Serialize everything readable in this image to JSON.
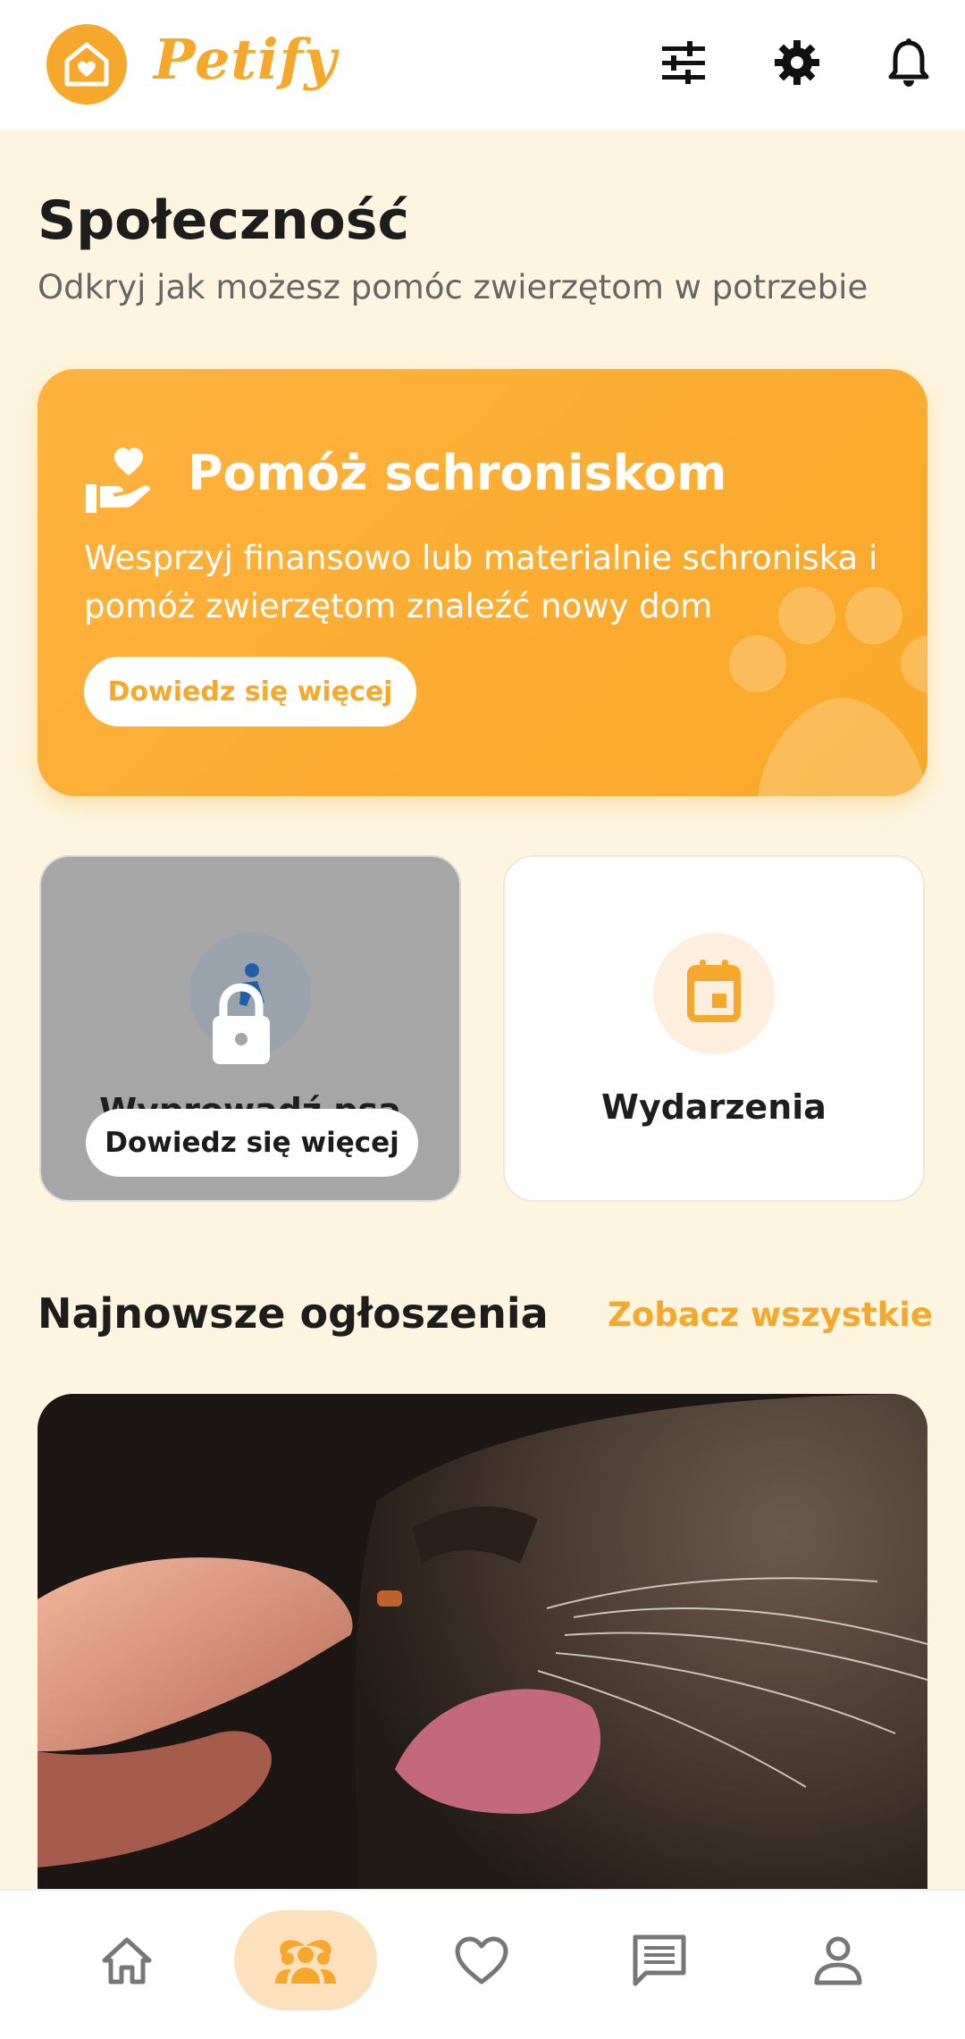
{
  "app": {
    "name": "Petify",
    "accent_color": "#f5a82c",
    "background_color": "#fdf5df"
  },
  "header": {
    "icons": [
      "filter-sliders-icon",
      "settings-gear-icon",
      "notifications-bell-icon"
    ]
  },
  "page": {
    "title": "Społeczność",
    "subtitle": "Odkryj jak możesz pomóc zwierzętom w potrzebie"
  },
  "hero": {
    "title": "Pomóż schroniskom",
    "description": "Wesprzyj finansowo lub materialnie schroniska i pomóż zwierzętom znaleźć nowy dom",
    "button_label": "Dowiedz się więcej"
  },
  "cards": {
    "walk": {
      "label": "Wyprowadź psa",
      "locked": true,
      "button_label": "Dowiedz się więcej"
    },
    "events": {
      "label": "Wydarzenia"
    }
  },
  "latest": {
    "title": "Najnowsze ogłoszenia",
    "see_all": "Zobacz wszystkie"
  },
  "bottom_nav": {
    "items": [
      "home-icon",
      "community-icon",
      "favorites-heart-icon",
      "messages-icon",
      "profile-icon"
    ],
    "active_index": 1
  }
}
